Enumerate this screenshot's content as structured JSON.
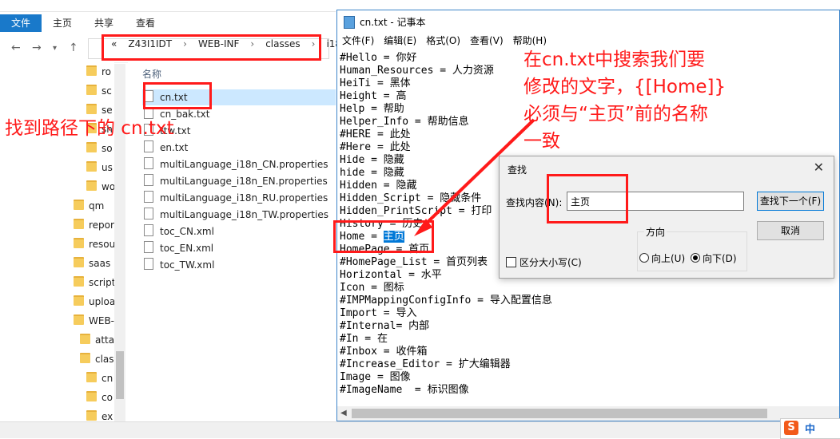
{
  "explorer": {
    "ribbon_tabs": [
      "文件",
      "主页",
      "共享",
      "查看"
    ],
    "breadcrumb": [
      "«",
      "Z43I1IDT",
      "WEB-INF",
      "classes",
      "i18n"
    ],
    "tree_items": [
      "ro",
      "sc",
      "se",
      "sh",
      "so",
      "us",
      "wo",
      "qm",
      "repor",
      "resou",
      "saas",
      "script",
      "uploa",
      "WEB-",
      "atta",
      "clas",
      "cn",
      "co",
      "ex"
    ],
    "column_name": "名称",
    "files": [
      "cn.txt",
      "cn_bak.txt",
      "ttw.txt",
      "en.txt",
      "multiLanguage_i18n_CN.properties",
      "multiLanguage_i18n_EN.properties",
      "multiLanguage_i18n_RU.properties",
      "multiLanguage_i18n_TW.properties",
      "toc_CN.xml",
      "toc_EN.xml",
      "toc_TW.xml"
    ]
  },
  "notepad": {
    "title": "cn.txt - 记事本",
    "menu": [
      "文件(F)",
      "编辑(E)",
      "格式(O)",
      "查看(V)",
      "帮助(H)"
    ],
    "lines": [
      "#Hello = 你好",
      "Human_Resources = 人力资源",
      "HeiTi = 黑体",
      "Height = 高",
      "Help = 帮助",
      "Helper_Info = 帮助信息",
      "#HERE = 此处",
      "#Here = 此处",
      "Hide = 隐藏",
      "hide = 隐藏",
      "Hidden = 隐藏",
      "Hidden_Script = 隐藏条件",
      "Hidden_PrintScript = 打印",
      "History = 历史",
      "Home = ",
      "HomePage = 首页",
      "#HomePage_List = 首页列表",
      "Horizontal = 水平",
      "Icon = 图标",
      "#IMPMappingConfigInfo = 导入配置信息",
      "Import = 导入",
      "#Internal= 内部",
      "#In = 在",
      "#Inbox = 收件箱",
      "#Increase_Editor = 扩大编辑器",
      "Image = 图像",
      "#ImageName  = 标识图像"
    ],
    "highlight_text": "主页"
  },
  "find_dialog": {
    "title": "查找",
    "label": "查找内容(N):",
    "value": "主页",
    "find_next": "查找下一个(F)",
    "cancel": "取消",
    "direction_label": "方向",
    "up": "向上(U)",
    "down": "向下(D)",
    "match_case": "区分大小写(C)"
  },
  "annotations": {
    "left": "找到路径下的 cn.txt",
    "right_line1": "在cn.txt中搜索我们要",
    "right_line2": "修改的文字，{[Home]}",
    "right_line3": "必须与“主页”前的名称",
    "right_line4": "一致"
  },
  "ime": {
    "logo": "S",
    "lang": "中"
  },
  "colors": {
    "accent": "#1979ca",
    "annotation": "#ff1a1a",
    "selection": "#0078d7"
  }
}
